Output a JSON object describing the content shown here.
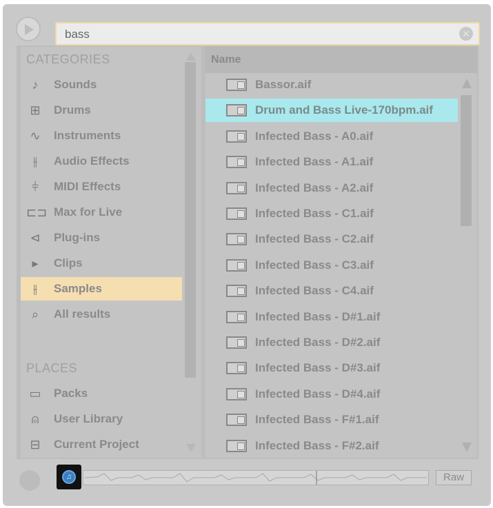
{
  "search": {
    "value": "bass"
  },
  "categories_header": "CATEGORIES",
  "places_header": "PLACES",
  "categories": [
    {
      "label": "Sounds",
      "icon": "note-icon",
      "glyph": "♪"
    },
    {
      "label": "Drums",
      "icon": "drums-grid-icon",
      "glyph": "⊞"
    },
    {
      "label": "Instruments",
      "icon": "waveform-icon",
      "glyph": "∿"
    },
    {
      "label": "Audio Effects",
      "icon": "audio-effects-icon",
      "glyph": "⫲"
    },
    {
      "label": "MIDI Effects",
      "icon": "midi-effects-icon",
      "glyph": "⫩"
    },
    {
      "label": "Max for Live",
      "icon": "max-for-live-icon",
      "glyph": "⊏⊐"
    },
    {
      "label": "Plug-ins",
      "icon": "plugin-icon",
      "glyph": "⊲"
    },
    {
      "label": "Clips",
      "icon": "clips-icon",
      "glyph": "▸"
    },
    {
      "label": "Samples",
      "icon": "samples-icon",
      "glyph": "⫲"
    },
    {
      "label": "All results",
      "icon": "search-icon",
      "glyph": "⌕"
    }
  ],
  "places": [
    {
      "label": "Packs",
      "icon": "packs-icon",
      "glyph": "▭"
    },
    {
      "label": "User Library",
      "icon": "user-icon",
      "glyph": "⍝"
    },
    {
      "label": "Current Project",
      "icon": "folder-icon",
      "glyph": "⊟"
    }
  ],
  "files_header": "Name",
  "files": [
    "Bassor.aif",
    "Drum and Bass Live-170bpm.aif",
    "Infected Bass - A0.aif",
    "Infected Bass - A1.aif",
    "Infected Bass - A2.aif",
    "Infected Bass - C1.aif",
    "Infected Bass - C2.aif",
    "Infected Bass - C3.aif",
    "Infected Bass - C4.aif",
    "Infected Bass - D#1.aif",
    "Infected Bass - D#2.aif",
    "Infected Bass - D#3.aif",
    "Infected Bass - D#4.aif",
    "Infected Bass - F#1.aif",
    "Infected Bass - F#2.aif"
  ],
  "selected_category": "Samples",
  "selected_file": "Drum and Bass Live-170bpm.aif",
  "raw_label": "Raw",
  "colors": {
    "selection_category": "#f5deb0",
    "selection_file": "#a9e8ec",
    "preview_accent": "#3a7fc0"
  }
}
